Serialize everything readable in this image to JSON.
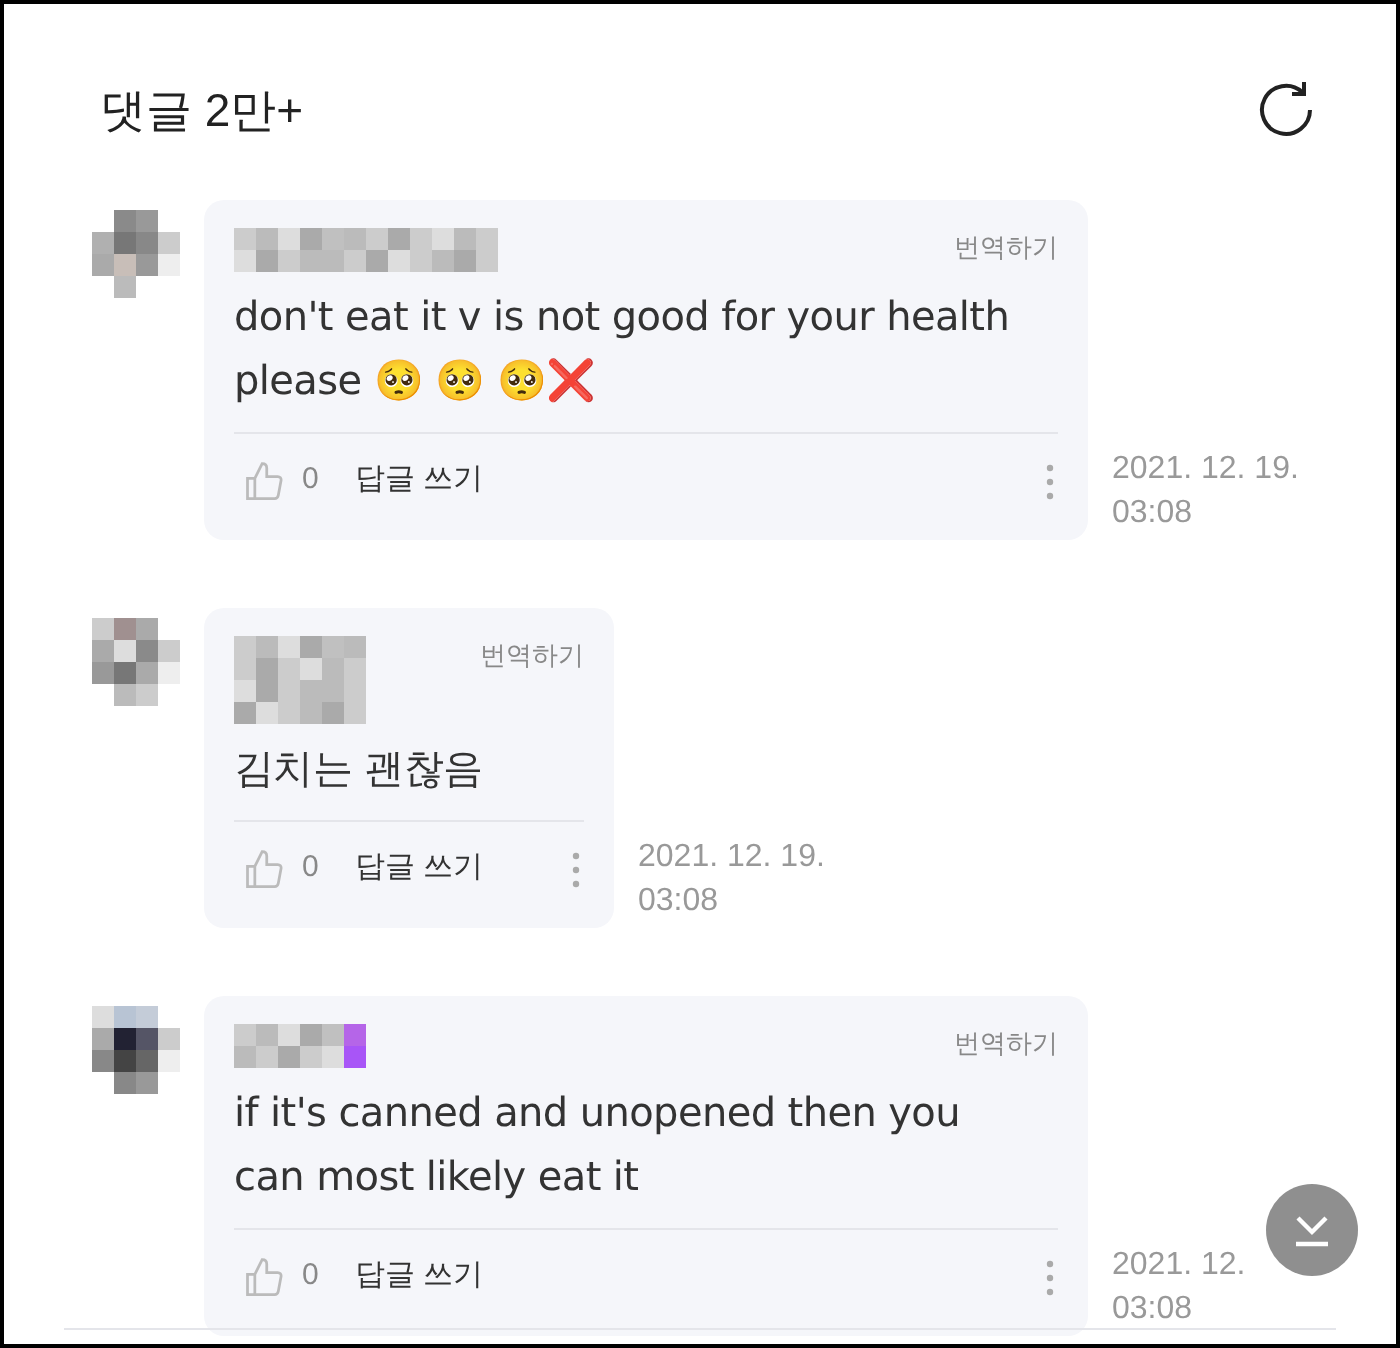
{
  "header": {
    "title": "댓글 2만+"
  },
  "comments": [
    {
      "translate": "번역하기",
      "text": "don't eat it v is not good for your health please 🥺 🥺 🥺❌",
      "likes": "0",
      "reply": "답글 쓰기",
      "time": "2021. 12. 19.\n03:08"
    },
    {
      "translate": "번역하기",
      "text": "김치는 괜찮음",
      "likes": "0",
      "reply": "답글 쓰기",
      "time": "2021. 12. 19.\n03:08"
    },
    {
      "translate": "번역하기",
      "text": "if it's canned and unopened then you can most likely eat it",
      "likes": "0",
      "reply": "답글 쓰기",
      "time": "2021. 12.\n03:08"
    }
  ]
}
